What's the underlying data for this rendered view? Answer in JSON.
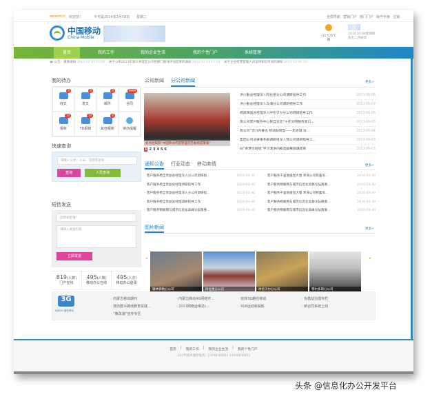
{
  "topbar": {
    "user": "wpadmin",
    "welcome": "欢迎您！",
    "date": "今天是2014年3月18日",
    "weekday": "星期二",
    "links": [
      "全局导航",
      "营销门户",
      "部门门户",
      "操作手册",
      "注销"
    ]
  },
  "header": {
    "logo_cn": "中国移动",
    "logo_en": "China Mobile",
    "weather": "-11℃/0℃",
    "weather_desc": "晴",
    "date_line1": "2014.03.04星期四",
    "date_line2": "农历二月初四"
  },
  "nav": [
    "首页",
    "我的工作",
    "我的企业生活",
    "我的个性门户",
    "系统管理"
  ],
  "notice": {
    "label": "公告：",
    "title": "重要通知",
    "items": [
      {
        "text": "2013-12-31 15:26"
      },
      {
        "text": "· 关于公布2013年第三季度区公司各部门绩效评估结果的通知",
        "date": "2013-12-23 11:19"
      },
      {
        "text": "· 关于企业经营管理人员法律知识考试的通知",
        "date": "2013-12-06 15:"
      }
    ]
  },
  "todo": {
    "title": "我的待办",
    "items": [
      {
        "label": "收文",
        "badge": "0"
      },
      {
        "label": "发文",
        "badge": "0"
      },
      {
        "label": "邮件",
        "badge": "0"
      },
      {
        "label": "合同",
        "badge": "9999"
      },
      {
        "label": "报账",
        "badge": "10"
      },
      {
        "label": "TD报账",
        "badge": "10"
      },
      {
        "label": "其他报账",
        "badge": "0"
      },
      {
        "label": "待办提醒",
        "badge": ""
      }
    ]
  },
  "quick": {
    "title": "快速查询",
    "placeholder": "请输入公文、人员、流程等查询",
    "query": "查询",
    "people": "人员查询"
  },
  "sms": {
    "title": "短信发送",
    "to_placeholder": "您想发给谁？",
    "content_placeholder": "请输入发送内容",
    "send": "立即发送"
  },
  "stats": [
    {
      "num": "819",
      "unit": "(人数)",
      "label": "门户在线"
    },
    {
      "num": "495",
      "unit": "(人数)",
      "label": "移动办公在线"
    },
    {
      "num": "495",
      "unit": "(人次)",
      "label": "移动办公登录"
    }
  ],
  "news": {
    "tabs": [
      "公司新闻",
      "分公司新闻"
    ],
    "more": "更多>",
    "caption": "焦点连续获“中国移动内部管理示范基地成果展”",
    "pages": [
      "1",
      "2",
      "3",
      "4",
      "5",
      "6"
    ],
    "items": [
      {
        "t": "· 洪小勤总经理深入阿拉善分公司调研指导工作",
        "d": "2013-06-08"
      },
      {
        "t": "· 洪小勤总经理深入乌海分公司调研指导工作",
        "d": "2013-06-07"
      },
      {
        "t": "· 杨跃辉副总经理深入呼伦贝尔分公司调研指导工作",
        "d": "2013-06-06"
      },
      {
        "t": "· 我公司客户服务中心获自治区“十佳文明服务窗口...",
        "d": "2013-06-05"
      },
      {
        "t": "· 我公司“活力内蒙古 移动助转型——走进城 访...",
        "d": "2013-06-04"
      },
      {
        "t": "· 集团公司法律事务部调研组深入我公司调研指导工...",
        "d": "2013-06-03"
      },
      {
        "t": "· 向“余梦伦班组”学习演讲内部选拔赛圆满结束",
        "d": "2013-06-03"
      }
    ]
  },
  "notices": {
    "tabs": [
      "通知公告",
      "行业动态",
      "移动商情"
    ],
    "more": "更多>",
    "left": [
      {
        "t": "· 客户服务杨全贵副总经理深入分公司调研指...",
        "d": "2010-03-30"
      },
      {
        "t": "· 客户服务杨全贵副总经理调研指导工作",
        "d": "2010-03-30"
      },
      {
        "t": "· 客户服务杨全贵副总经理深入分公司调研指...",
        "d": "2010-03-30"
      },
      {
        "t": "· 客户服务杨全贵副总经理调研指导工作",
        "d": "2010-03-30"
      },
      {
        "t": "· 客户服务物联网与城市信息化高峰论坛隆重...",
        "d": "2010-03-30"
      }
    ],
    "right": [
      {
        "t": "· 客户服务千里驰援昆大蜀 青海公司积蓄军...",
        "d": "2010-03-30"
      },
      {
        "t": "· 客户服务物联网与城市信息化高峰论坛隆重...",
        "d": "2010-03-30"
      },
      {
        "t": "· 客户服务千里驰援昆大蜀 青海公司积蓄军...",
        "d": "2010-03-30"
      },
      {
        "t": "· 客户服务物联网与城市信息化高峰论坛隆重...",
        "d": "2010-03-30"
      },
      {
        "t": "· 客户服务物联网与城市信息化高峰论坛隆重...",
        "d": "2010-03-30"
      }
    ]
  },
  "pics": {
    "title": "图片新闻",
    "more": "更多>",
    "items": [
      "锡林郭勒分公司",
      "阿拉善分公司",
      "呼伦贝尔分公司",
      "鄂尔多斯分公司"
    ]
  },
  "links": {
    "logo_text": "玩转3G 趣在移动",
    "items": [
      "· 内蒙古移动期刊",
      "· 内蒙古移动4G网络开...",
      "· 玩转3G趣在移动",
      "· 伪基站治理专栏",
      "· 党的群众路线教育实践...",
      "· 2013网络运维见L...",
      "· 916运动就锻炼",
      "· 新合同系统上线",
      "· “教改潮”宣传专区"
    ]
  },
  "footer": {
    "links": [
      "首页",
      "我的工作",
      "我的企业生活",
      "我的个性门户"
    ],
    "hotline": "24小时技术服务电话：13948100852  13948100853"
  },
  "watermark": "头条 @信息化办公开发平台"
}
